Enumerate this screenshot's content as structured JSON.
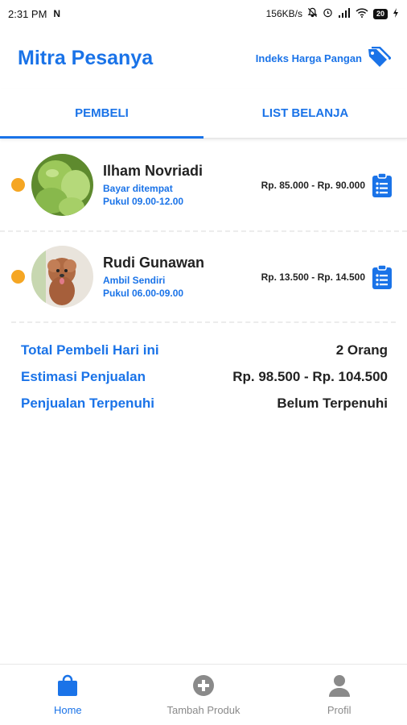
{
  "status_bar": {
    "time": "2:31 PM",
    "network_speed": "156KB/s",
    "battery": "20"
  },
  "header": {
    "title": "Mitra Pesanya",
    "index_link": "Indeks Harga Pangan"
  },
  "tabs": [
    {
      "label": "PEMBELI",
      "active": true
    },
    {
      "label": "LIST BELANJA",
      "active": false
    }
  ],
  "buyers": [
    {
      "name": "Ilham Novriadi",
      "payment": "Bayar ditempat",
      "time": "Pukul 09.00-12.00",
      "price_range": "Rp. 85.000 - Rp. 90.000",
      "status_color": "#F5A623"
    },
    {
      "name": "Rudi Gunawan",
      "payment": "Ambil Sendiri",
      "time": "Pukul 06.00-09.00",
      "price_range": "Rp. 13.500 - Rp. 14.500",
      "status_color": "#F5A623"
    }
  ],
  "summary": {
    "total_buyers_label": "Total Pembeli Hari ini",
    "total_buyers_value": "2 Orang",
    "estimate_label": "Estimasi Penjualan",
    "estimate_value": "Rp. 98.500 - Rp. 104.500",
    "fulfilled_label": "Penjualan Terpenuhi",
    "fulfilled_value": "Belum Terpenuhi"
  },
  "bottom_nav": [
    {
      "label": "Home",
      "icon": "shopping-bag-icon",
      "active": true
    },
    {
      "label": "Tambah Produk",
      "icon": "plus-circle-icon",
      "active": false
    },
    {
      "label": "Profil",
      "icon": "person-icon",
      "active": false
    }
  ],
  "colors": {
    "accent": "#1A73E8",
    "status_pending": "#F5A623",
    "inactive": "#8A8A8A"
  }
}
